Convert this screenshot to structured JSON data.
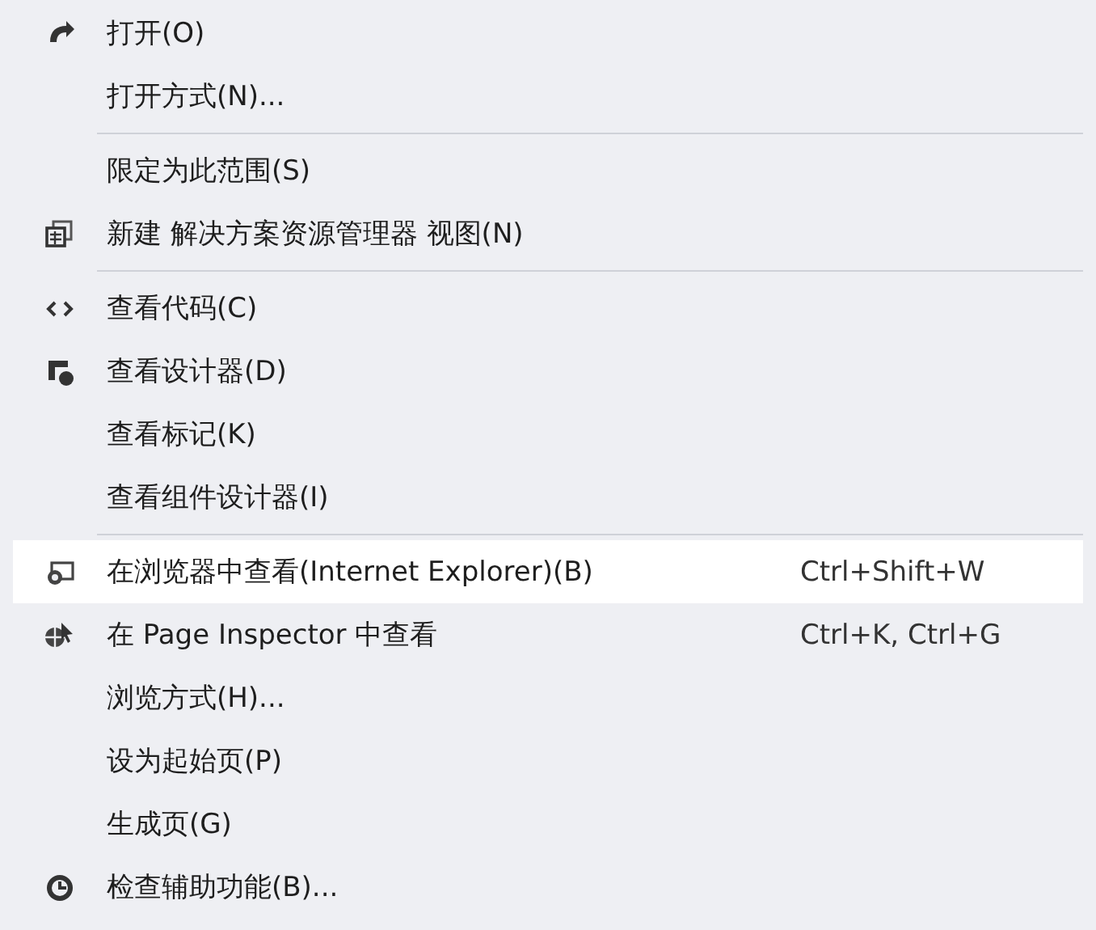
{
  "menu": {
    "groups": [
      [
        {
          "label": "打开(O)",
          "highlighted": false
        },
        {
          "label": "打开方式(N)...",
          "highlighted": false
        }
      ],
      [
        {
          "label": "限定为此范围(S)",
          "highlighted": false
        },
        {
          "label": "新建 解决方案资源管理器 视图(N)",
          "highlighted": false
        }
      ],
      [
        {
          "label": "查看代码(C)",
          "highlighted": false
        },
        {
          "label": "查看设计器(D)",
          "highlighted": false
        },
        {
          "label": "查看标记(K)",
          "highlighted": false
        },
        {
          "label": "查看组件设计器(I)",
          "highlighted": false
        }
      ],
      [
        {
          "label": "在浏览器中查看(Internet Explorer)(B)",
          "shortcut": "Ctrl+Shift+W",
          "highlighted": true
        },
        {
          "label": "在 Page Inspector 中查看",
          "shortcut": "Ctrl+K, Ctrl+G",
          "highlighted": false
        },
        {
          "label": "浏览方式(H)...",
          "highlighted": false
        },
        {
          "label": "设为起始页(P)",
          "highlighted": false
        },
        {
          "label": "生成页(G)",
          "highlighted": false
        },
        {
          "label": "检查辅助功能(B)...",
          "highlighted": false
        }
      ]
    ]
  }
}
